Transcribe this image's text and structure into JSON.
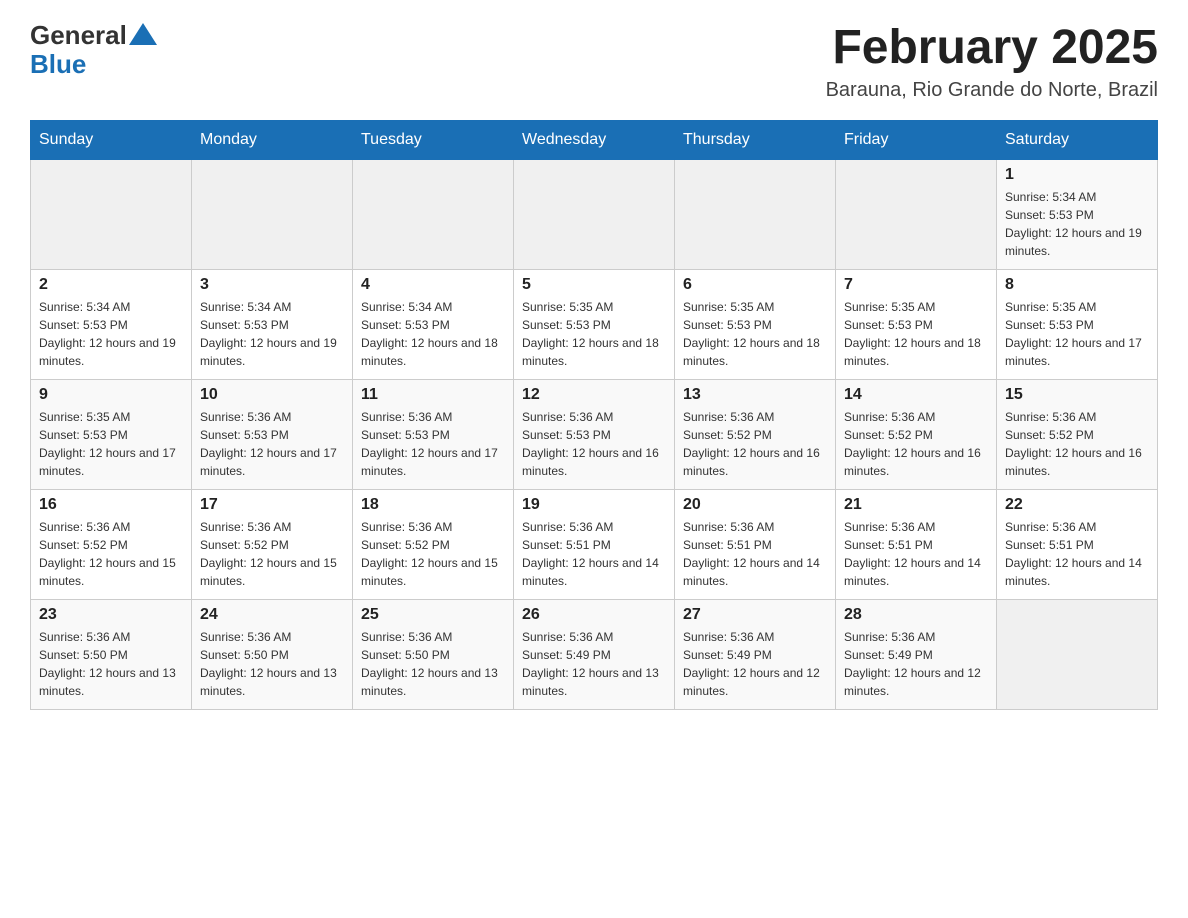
{
  "header": {
    "logo": {
      "general_text": "General",
      "blue_text": "Blue"
    },
    "title": "February 2025",
    "location": "Barauna, Rio Grande do Norte, Brazil"
  },
  "days_of_week": [
    "Sunday",
    "Monday",
    "Tuesday",
    "Wednesday",
    "Thursday",
    "Friday",
    "Saturday"
  ],
  "weeks": [
    {
      "days": [
        {
          "number": "",
          "empty": true
        },
        {
          "number": "",
          "empty": true
        },
        {
          "number": "",
          "empty": true
        },
        {
          "number": "",
          "empty": true
        },
        {
          "number": "",
          "empty": true
        },
        {
          "number": "",
          "empty": true
        },
        {
          "number": "1",
          "sunrise": "Sunrise: 5:34 AM",
          "sunset": "Sunset: 5:53 PM",
          "daylight": "Daylight: 12 hours and 19 minutes."
        }
      ]
    },
    {
      "days": [
        {
          "number": "2",
          "sunrise": "Sunrise: 5:34 AM",
          "sunset": "Sunset: 5:53 PM",
          "daylight": "Daylight: 12 hours and 19 minutes."
        },
        {
          "number": "3",
          "sunrise": "Sunrise: 5:34 AM",
          "sunset": "Sunset: 5:53 PM",
          "daylight": "Daylight: 12 hours and 19 minutes."
        },
        {
          "number": "4",
          "sunrise": "Sunrise: 5:34 AM",
          "sunset": "Sunset: 5:53 PM",
          "daylight": "Daylight: 12 hours and 18 minutes."
        },
        {
          "number": "5",
          "sunrise": "Sunrise: 5:35 AM",
          "sunset": "Sunset: 5:53 PM",
          "daylight": "Daylight: 12 hours and 18 minutes."
        },
        {
          "number": "6",
          "sunrise": "Sunrise: 5:35 AM",
          "sunset": "Sunset: 5:53 PM",
          "daylight": "Daylight: 12 hours and 18 minutes."
        },
        {
          "number": "7",
          "sunrise": "Sunrise: 5:35 AM",
          "sunset": "Sunset: 5:53 PM",
          "daylight": "Daylight: 12 hours and 18 minutes."
        },
        {
          "number": "8",
          "sunrise": "Sunrise: 5:35 AM",
          "sunset": "Sunset: 5:53 PM",
          "daylight": "Daylight: 12 hours and 17 minutes."
        }
      ]
    },
    {
      "days": [
        {
          "number": "9",
          "sunrise": "Sunrise: 5:35 AM",
          "sunset": "Sunset: 5:53 PM",
          "daylight": "Daylight: 12 hours and 17 minutes."
        },
        {
          "number": "10",
          "sunrise": "Sunrise: 5:36 AM",
          "sunset": "Sunset: 5:53 PM",
          "daylight": "Daylight: 12 hours and 17 minutes."
        },
        {
          "number": "11",
          "sunrise": "Sunrise: 5:36 AM",
          "sunset": "Sunset: 5:53 PM",
          "daylight": "Daylight: 12 hours and 17 minutes."
        },
        {
          "number": "12",
          "sunrise": "Sunrise: 5:36 AM",
          "sunset": "Sunset: 5:53 PM",
          "daylight": "Daylight: 12 hours and 16 minutes."
        },
        {
          "number": "13",
          "sunrise": "Sunrise: 5:36 AM",
          "sunset": "Sunset: 5:52 PM",
          "daylight": "Daylight: 12 hours and 16 minutes."
        },
        {
          "number": "14",
          "sunrise": "Sunrise: 5:36 AM",
          "sunset": "Sunset: 5:52 PM",
          "daylight": "Daylight: 12 hours and 16 minutes."
        },
        {
          "number": "15",
          "sunrise": "Sunrise: 5:36 AM",
          "sunset": "Sunset: 5:52 PM",
          "daylight": "Daylight: 12 hours and 16 minutes."
        }
      ]
    },
    {
      "days": [
        {
          "number": "16",
          "sunrise": "Sunrise: 5:36 AM",
          "sunset": "Sunset: 5:52 PM",
          "daylight": "Daylight: 12 hours and 15 minutes."
        },
        {
          "number": "17",
          "sunrise": "Sunrise: 5:36 AM",
          "sunset": "Sunset: 5:52 PM",
          "daylight": "Daylight: 12 hours and 15 minutes."
        },
        {
          "number": "18",
          "sunrise": "Sunrise: 5:36 AM",
          "sunset": "Sunset: 5:52 PM",
          "daylight": "Daylight: 12 hours and 15 minutes."
        },
        {
          "number": "19",
          "sunrise": "Sunrise: 5:36 AM",
          "sunset": "Sunset: 5:51 PM",
          "daylight": "Daylight: 12 hours and 14 minutes."
        },
        {
          "number": "20",
          "sunrise": "Sunrise: 5:36 AM",
          "sunset": "Sunset: 5:51 PM",
          "daylight": "Daylight: 12 hours and 14 minutes."
        },
        {
          "number": "21",
          "sunrise": "Sunrise: 5:36 AM",
          "sunset": "Sunset: 5:51 PM",
          "daylight": "Daylight: 12 hours and 14 minutes."
        },
        {
          "number": "22",
          "sunrise": "Sunrise: 5:36 AM",
          "sunset": "Sunset: 5:51 PM",
          "daylight": "Daylight: 12 hours and 14 minutes."
        }
      ]
    },
    {
      "days": [
        {
          "number": "23",
          "sunrise": "Sunrise: 5:36 AM",
          "sunset": "Sunset: 5:50 PM",
          "daylight": "Daylight: 12 hours and 13 minutes."
        },
        {
          "number": "24",
          "sunrise": "Sunrise: 5:36 AM",
          "sunset": "Sunset: 5:50 PM",
          "daylight": "Daylight: 12 hours and 13 minutes."
        },
        {
          "number": "25",
          "sunrise": "Sunrise: 5:36 AM",
          "sunset": "Sunset: 5:50 PM",
          "daylight": "Daylight: 12 hours and 13 minutes."
        },
        {
          "number": "26",
          "sunrise": "Sunrise: 5:36 AM",
          "sunset": "Sunset: 5:49 PM",
          "daylight": "Daylight: 12 hours and 13 minutes."
        },
        {
          "number": "27",
          "sunrise": "Sunrise: 5:36 AM",
          "sunset": "Sunset: 5:49 PM",
          "daylight": "Daylight: 12 hours and 12 minutes."
        },
        {
          "number": "28",
          "sunrise": "Sunrise: 5:36 AM",
          "sunset": "Sunset: 5:49 PM",
          "daylight": "Daylight: 12 hours and 12 minutes."
        },
        {
          "number": "",
          "empty": true
        }
      ]
    }
  ]
}
